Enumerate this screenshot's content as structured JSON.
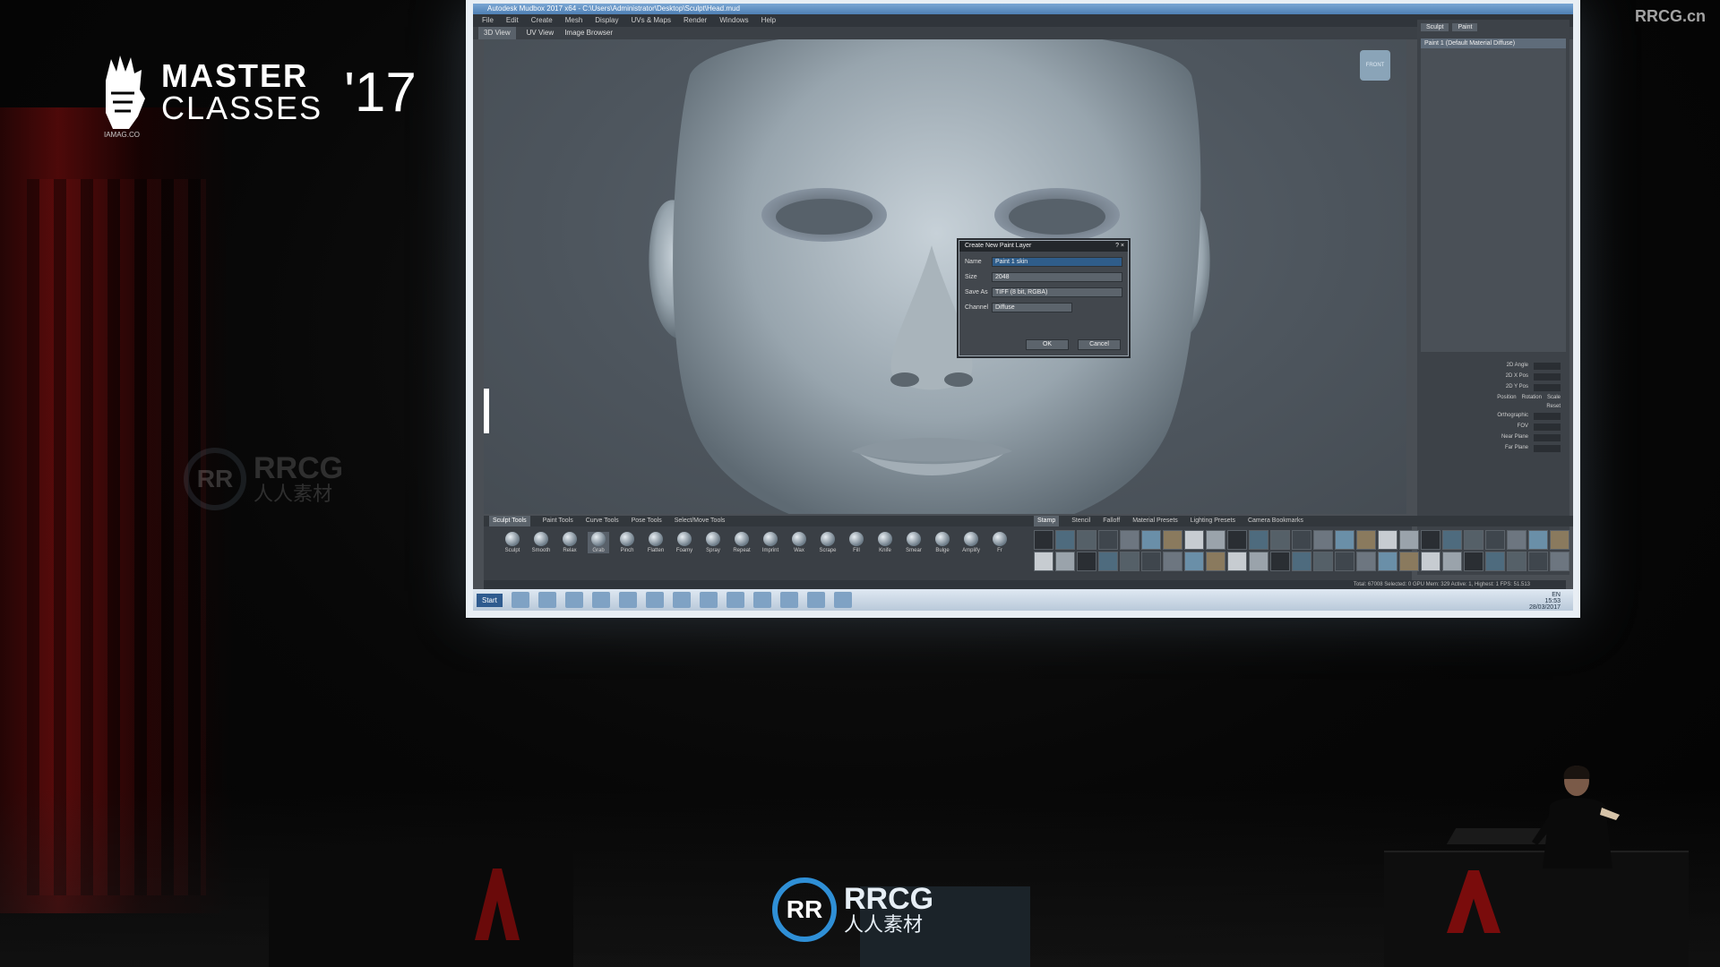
{
  "conference": {
    "master": "MASTER",
    "classes": "CLASSES",
    "year": "'17",
    "small": "IAMAG.CO"
  },
  "watermark_top": "RRCG.cn",
  "watermark": {
    "icon": "RR",
    "line1": "RRCG",
    "line2": "人人素材"
  },
  "app": {
    "title": "Autodesk Mudbox 2017 x64 - C:\\Users\\Administrator\\Desktop\\Sculpt\\Head.mud",
    "menus": [
      "File",
      "Edit",
      "Create",
      "Mesh",
      "Display",
      "UVs & Maps",
      "Render",
      "Windows",
      "Help"
    ],
    "view_tabs": [
      "3D View",
      "UV View",
      "Image Browser"
    ],
    "viewcube": "FRONT",
    "right_tabs": [
      "Sculpt",
      "Paint"
    ],
    "layer_name": "Paint 1 (Default Material Diffuse)",
    "props": [
      "2D Angle",
      "2D X Pos",
      "2D Y Pos",
      "Position",
      "Rotation",
      "Scale",
      "Reset",
      "Orthographic",
      "FOV",
      "Near Plane",
      "Far Plane"
    ],
    "status": "Total: 67008  Selected: 0  GPU Mem: 329  Active: 1, Highest: 1  FPS: 51.513"
  },
  "dialog": {
    "title": "Create New Paint Layer",
    "fields": [
      {
        "label": "Name",
        "value": "Paint 1 skin"
      },
      {
        "label": "Size",
        "value": "2048"
      },
      {
        "label": "Save As",
        "value": "TIFF (8 bit, RGBA)"
      },
      {
        "label": "Channel",
        "value": "Diffuse"
      }
    ],
    "ok": "OK",
    "cancel": "Cancel"
  },
  "trays": {
    "left_tabs": [
      "Sculpt Tools",
      "Paint Tools",
      "Curve Tools",
      "Pose Tools",
      "Select/Move Tools"
    ],
    "tools": [
      "Sculpt",
      "Smooth",
      "Relax",
      "Grab",
      "Pinch",
      "Flatten",
      "Foamy",
      "Spray",
      "Repeat",
      "Imprint",
      "Wax",
      "Scrape",
      "Fill",
      "Knife",
      "Smear",
      "Bulge",
      "Amplify",
      "Fr"
    ],
    "right_tabs": [
      "Stamp",
      "Stencil",
      "Falloff",
      "Material Presets",
      "Lighting Presets",
      "Camera Bookmarks"
    ]
  },
  "taskbar": {
    "start": "Start",
    "clock_time": "15:53",
    "clock_date": "28/03/2017",
    "lang": "EN"
  }
}
